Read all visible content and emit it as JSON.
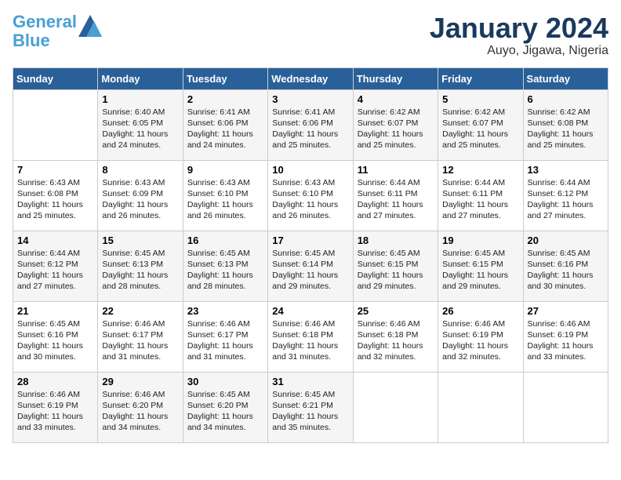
{
  "logo": {
    "line1": "General",
    "line2": "Blue"
  },
  "header": {
    "month_year": "January 2024",
    "location": "Auyo, Jigawa, Nigeria"
  },
  "days_of_week": [
    "Sunday",
    "Monday",
    "Tuesday",
    "Wednesday",
    "Thursday",
    "Friday",
    "Saturday"
  ],
  "weeks": [
    [
      {
        "num": "",
        "info": ""
      },
      {
        "num": "1",
        "info": "Sunrise: 6:40 AM\nSunset: 6:05 PM\nDaylight: 11 hours\nand 24 minutes."
      },
      {
        "num": "2",
        "info": "Sunrise: 6:41 AM\nSunset: 6:06 PM\nDaylight: 11 hours\nand 24 minutes."
      },
      {
        "num": "3",
        "info": "Sunrise: 6:41 AM\nSunset: 6:06 PM\nDaylight: 11 hours\nand 25 minutes."
      },
      {
        "num": "4",
        "info": "Sunrise: 6:42 AM\nSunset: 6:07 PM\nDaylight: 11 hours\nand 25 minutes."
      },
      {
        "num": "5",
        "info": "Sunrise: 6:42 AM\nSunset: 6:07 PM\nDaylight: 11 hours\nand 25 minutes."
      },
      {
        "num": "6",
        "info": "Sunrise: 6:42 AM\nSunset: 6:08 PM\nDaylight: 11 hours\nand 25 minutes."
      }
    ],
    [
      {
        "num": "7",
        "info": "Sunrise: 6:43 AM\nSunset: 6:08 PM\nDaylight: 11 hours\nand 25 minutes."
      },
      {
        "num": "8",
        "info": "Sunrise: 6:43 AM\nSunset: 6:09 PM\nDaylight: 11 hours\nand 26 minutes."
      },
      {
        "num": "9",
        "info": "Sunrise: 6:43 AM\nSunset: 6:10 PM\nDaylight: 11 hours\nand 26 minutes."
      },
      {
        "num": "10",
        "info": "Sunrise: 6:43 AM\nSunset: 6:10 PM\nDaylight: 11 hours\nand 26 minutes."
      },
      {
        "num": "11",
        "info": "Sunrise: 6:44 AM\nSunset: 6:11 PM\nDaylight: 11 hours\nand 27 minutes."
      },
      {
        "num": "12",
        "info": "Sunrise: 6:44 AM\nSunset: 6:11 PM\nDaylight: 11 hours\nand 27 minutes."
      },
      {
        "num": "13",
        "info": "Sunrise: 6:44 AM\nSunset: 6:12 PM\nDaylight: 11 hours\nand 27 minutes."
      }
    ],
    [
      {
        "num": "14",
        "info": "Sunrise: 6:44 AM\nSunset: 6:12 PM\nDaylight: 11 hours\nand 27 minutes."
      },
      {
        "num": "15",
        "info": "Sunrise: 6:45 AM\nSunset: 6:13 PM\nDaylight: 11 hours\nand 28 minutes."
      },
      {
        "num": "16",
        "info": "Sunrise: 6:45 AM\nSunset: 6:13 PM\nDaylight: 11 hours\nand 28 minutes."
      },
      {
        "num": "17",
        "info": "Sunrise: 6:45 AM\nSunset: 6:14 PM\nDaylight: 11 hours\nand 29 minutes."
      },
      {
        "num": "18",
        "info": "Sunrise: 6:45 AM\nSunset: 6:15 PM\nDaylight: 11 hours\nand 29 minutes."
      },
      {
        "num": "19",
        "info": "Sunrise: 6:45 AM\nSunset: 6:15 PM\nDaylight: 11 hours\nand 29 minutes."
      },
      {
        "num": "20",
        "info": "Sunrise: 6:45 AM\nSunset: 6:16 PM\nDaylight: 11 hours\nand 30 minutes."
      }
    ],
    [
      {
        "num": "21",
        "info": "Sunrise: 6:45 AM\nSunset: 6:16 PM\nDaylight: 11 hours\nand 30 minutes."
      },
      {
        "num": "22",
        "info": "Sunrise: 6:46 AM\nSunset: 6:17 PM\nDaylight: 11 hours\nand 31 minutes."
      },
      {
        "num": "23",
        "info": "Sunrise: 6:46 AM\nSunset: 6:17 PM\nDaylight: 11 hours\nand 31 minutes."
      },
      {
        "num": "24",
        "info": "Sunrise: 6:46 AM\nSunset: 6:18 PM\nDaylight: 11 hours\nand 31 minutes."
      },
      {
        "num": "25",
        "info": "Sunrise: 6:46 AM\nSunset: 6:18 PM\nDaylight: 11 hours\nand 32 minutes."
      },
      {
        "num": "26",
        "info": "Sunrise: 6:46 AM\nSunset: 6:19 PM\nDaylight: 11 hours\nand 32 minutes."
      },
      {
        "num": "27",
        "info": "Sunrise: 6:46 AM\nSunset: 6:19 PM\nDaylight: 11 hours\nand 33 minutes."
      }
    ],
    [
      {
        "num": "28",
        "info": "Sunrise: 6:46 AM\nSunset: 6:19 PM\nDaylight: 11 hours\nand 33 minutes."
      },
      {
        "num": "29",
        "info": "Sunrise: 6:46 AM\nSunset: 6:20 PM\nDaylight: 11 hours\nand 34 minutes."
      },
      {
        "num": "30",
        "info": "Sunrise: 6:45 AM\nSunset: 6:20 PM\nDaylight: 11 hours\nand 34 minutes."
      },
      {
        "num": "31",
        "info": "Sunrise: 6:45 AM\nSunset: 6:21 PM\nDaylight: 11 hours\nand 35 minutes."
      },
      {
        "num": "",
        "info": ""
      },
      {
        "num": "",
        "info": ""
      },
      {
        "num": "",
        "info": ""
      }
    ]
  ]
}
